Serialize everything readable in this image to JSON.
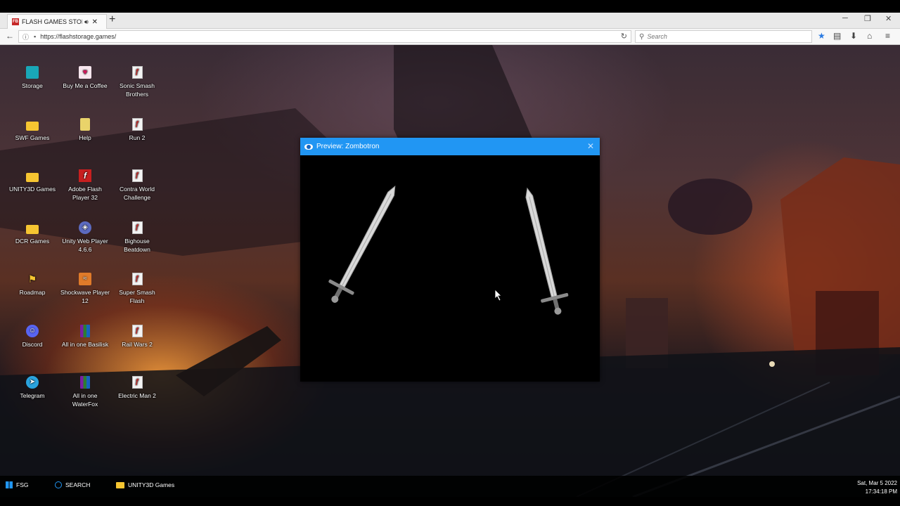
{
  "browser": {
    "tab": {
      "favicon": "FB",
      "title": "FLASH GAMES STORAGE",
      "audio_icon": "speaker-icon",
      "close": "✕"
    },
    "new_tab": "+",
    "window_controls": {
      "minimize": "─",
      "restore": "❐",
      "close": "✕"
    },
    "url": "https://flashstorage.games/",
    "search_placeholder": "Search"
  },
  "desktop": {
    "icons": [
      {
        "id": "storage",
        "label": "Storage",
        "icon": "monitor-icon"
      },
      {
        "id": "buy-me-a-coffee",
        "label": "Buy Me a Coffee",
        "icon": "coffee-icon"
      },
      {
        "id": "sonic-smash-brothers",
        "label": "Sonic Smash Brothers",
        "icon": "swf-file-icon"
      },
      {
        "id": "swf-games",
        "label": "SWF Games",
        "icon": "folder-icon"
      },
      {
        "id": "help",
        "label": "Help",
        "icon": "notepad-icon"
      },
      {
        "id": "run-2",
        "label": "Run 2",
        "icon": "swf-file-icon"
      },
      {
        "id": "unity3d-games",
        "label": "UNITY3D Games",
        "icon": "folder-icon"
      },
      {
        "id": "adobe-flash-player-32",
        "label": "Adobe Flash Player 32",
        "icon": "flash-icon"
      },
      {
        "id": "contra-world-challenge",
        "label": "Contra World Challenge",
        "icon": "swf-file-icon"
      },
      {
        "id": "dcr-games",
        "label": "DCR Games",
        "icon": "folder-icon"
      },
      {
        "id": "unity-web-player",
        "label": "Unity Web Player 4.6.6",
        "icon": "unity-icon"
      },
      {
        "id": "bighouse-beatdown",
        "label": "Bighouse Beatdown",
        "icon": "swf-file-icon"
      },
      {
        "id": "roadmap",
        "label": "Roadmap",
        "icon": "roadmap-icon"
      },
      {
        "id": "shockwave-player-12",
        "label": "Shockwave Player 12",
        "icon": "shockwave-icon"
      },
      {
        "id": "super-smash-flash",
        "label": "Super Smash Flash",
        "icon": "swf-file-icon"
      },
      {
        "id": "discord",
        "label": "Discord",
        "icon": "discord-icon"
      },
      {
        "id": "all-in-one-basilisk",
        "label": "All in one Basilisk",
        "icon": "archive-icon"
      },
      {
        "id": "rail-wars",
        "label": "Rail Wars 2",
        "icon": "swf-file-icon"
      },
      {
        "id": "telegram",
        "label": "Telegram",
        "icon": "telegram-icon"
      },
      {
        "id": "all-in-one-waterfox",
        "label": "All in one WaterFox",
        "icon": "archive-icon"
      },
      {
        "id": "electric-man-2",
        "label": "Electric Man 2",
        "icon": "swf-file-icon"
      }
    ]
  },
  "preview": {
    "title": "Preview: Zombotron",
    "close": "✕"
  },
  "taskbar": {
    "start_label": "FSG",
    "search_label": "SEARCH",
    "open_window_label": "UNITY3D Games",
    "date": "Sat, Mar 5 2022",
    "time": "17:34:18 PM"
  }
}
